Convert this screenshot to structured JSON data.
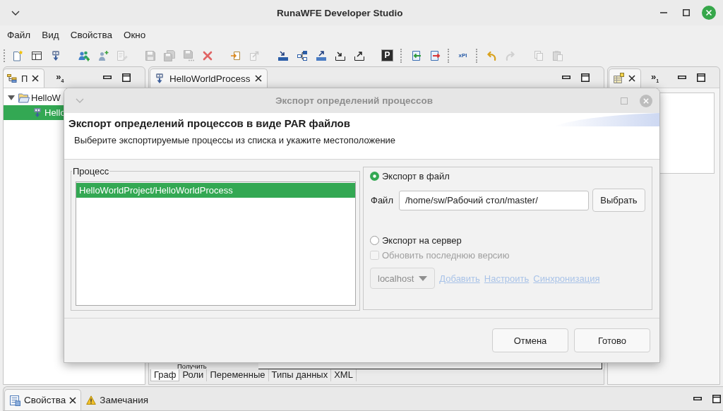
{
  "window": {
    "title": "RunaWFE Developer Studio"
  },
  "menu": [
    "Файл",
    "Вид",
    "Свойства",
    "Окно"
  ],
  "toolbar": [
    {
      "kind": "group",
      "items": [
        {
          "kind": "new-file",
          "disabled": false
        },
        {
          "kind": "window",
          "disabled": false
        },
        {
          "kind": "process",
          "disabled": false
        }
      ]
    },
    {
      "kind": "group",
      "items": [
        {
          "kind": "users",
          "disabled": false
        },
        {
          "kind": "add-user",
          "disabled": false
        },
        {
          "kind": "edit",
          "disabled": true
        }
      ]
    },
    {
      "kind": "group",
      "items": [
        {
          "kind": "save",
          "disabled": true
        },
        {
          "kind": "save-all",
          "disabled": true
        },
        {
          "kind": "save-as",
          "disabled": true
        },
        {
          "kind": "delete",
          "disabled": false
        }
      ]
    },
    {
      "kind": "group",
      "items": [
        {
          "kind": "import",
          "disabled": false
        },
        {
          "kind": "export",
          "disabled": true
        }
      ]
    },
    {
      "kind": "group",
      "items": [
        {
          "kind": "tray-in",
          "disabled": false
        },
        {
          "kind": "boxes",
          "disabled": false
        },
        {
          "kind": "tray-out",
          "disabled": false
        },
        {
          "kind": "arrow-in",
          "disabled": false
        },
        {
          "kind": "arrow-out",
          "disabled": false
        }
      ]
    },
    {
      "kind": "group",
      "items": [
        {
          "kind": "letter",
          "label": "P",
          "disabled": false
        }
      ]
    },
    {
      "kind": "separator"
    },
    {
      "kind": "group",
      "items": [
        {
          "kind": "doc-left",
          "disabled": false
        },
        {
          "kind": "doc-right",
          "disabled": false
        }
      ]
    },
    {
      "kind": "separator"
    },
    {
      "kind": "group",
      "items": [
        {
          "kind": "badge",
          "label": "xPI",
          "disabled": false
        }
      ]
    },
    {
      "kind": "separator"
    },
    {
      "kind": "group",
      "items": [
        {
          "kind": "undo",
          "disabled": false
        },
        {
          "kind": "redo",
          "disabled": true
        }
      ]
    },
    {
      "kind": "group",
      "items": [
        {
          "kind": "copy",
          "disabled": true
        },
        {
          "kind": "paste",
          "disabled": true
        }
      ]
    }
  ],
  "left_panel": {
    "tab": {
      "label": "П"
    },
    "overflow": {
      "label": "»",
      "count": "4"
    },
    "tree": [
      {
        "kind": "project",
        "label": "HelloW",
        "expanded": true,
        "selected": false,
        "children": [
          {
            "kind": "process",
            "label": "Hello",
            "selected": true
          }
        ]
      }
    ]
  },
  "editor": {
    "tab": {
      "label": "HelloWorldProcess"
    },
    "palette_item": "Получить",
    "tabs": [
      {
        "label": "Граф",
        "selected": true
      },
      {
        "label": "Роли",
        "selected": false
      },
      {
        "label": "Переменные",
        "selected": false
      },
      {
        "label": "Типы данных",
        "selected": false
      },
      {
        "label": "XML",
        "selected": false
      }
    ]
  },
  "right_panel": {
    "overflow": {
      "label": "»",
      "count": "1"
    }
  },
  "dialog": {
    "title": "Экспорт определений процессов",
    "heading": "Экспорт определений процессов в виде PAR файлов",
    "description": "Выберите экспортируемые процессы из списка и укажите местоположение",
    "process_group": {
      "label": "Процесс",
      "items": [
        {
          "label": "HelloWorldProject/HelloWorldProcess",
          "selected": true
        }
      ]
    },
    "export_options": [
      {
        "label": "Экспорт в файл",
        "selected": true
      },
      {
        "label": "Экспорт на сервер",
        "selected": false
      }
    ],
    "file": {
      "label": "Файл",
      "value": "/home/sw/Рабочий стол/master/",
      "button": "Выбрать"
    },
    "update_latest": {
      "label": "Обновить последнюю версию",
      "checked": false,
      "disabled": true
    },
    "server": {
      "value": "localhost",
      "disabled": true
    },
    "server_links": [
      {
        "label": "Добавить",
        "disabled": true
      },
      {
        "label": "Настроить",
        "disabled": true
      },
      {
        "label": "Синхронизация",
        "disabled": true
      }
    ],
    "buttons": [
      "Отмена",
      "Готово"
    ]
  },
  "bottom_panel": {
    "tabs": [
      {
        "kind": "properties",
        "label": "Свойства",
        "selected": true,
        "closable": true
      },
      {
        "kind": "problems",
        "label": "Замечания",
        "selected": false,
        "closable": false
      }
    ]
  }
}
